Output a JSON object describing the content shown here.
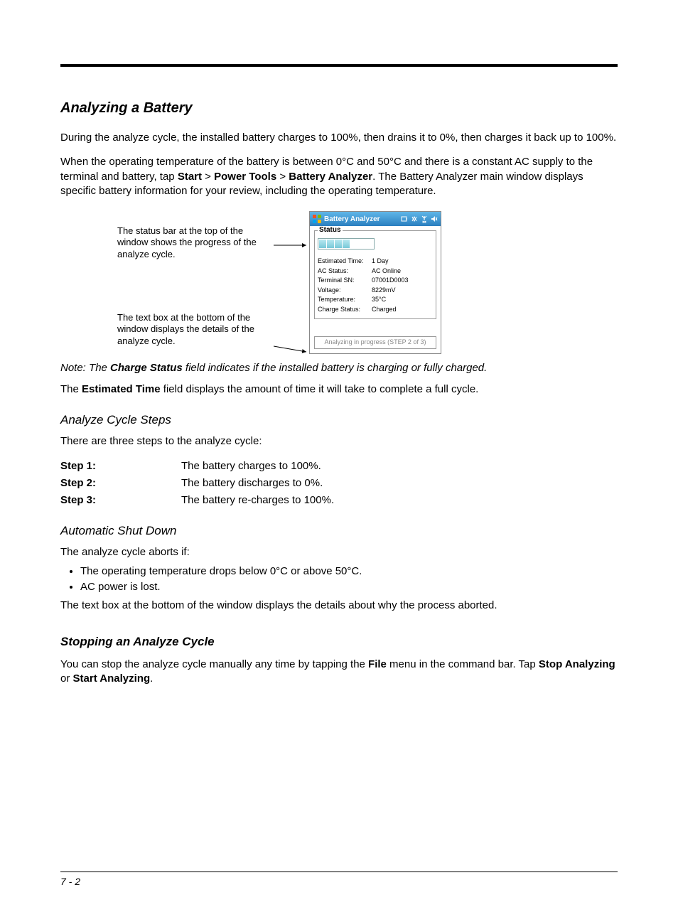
{
  "heading_analyzing": "Analyzing a Battery",
  "para1": "During the analyze cycle, the installed battery charges to 100%, then drains it to 0%, then charges it back up to 100%.",
  "para2_a": "When the operating temperature of the battery is between 0°C and 50°C and there is a constant AC supply to the terminal and battery, tap ",
  "para2_start": "Start",
  "para2_gt1": " > ",
  "para2_pt": "Power Tools",
  "para2_gt2": " > ",
  "para2_ba": "Battery Analyzer",
  "para2_b": ". The Battery Analyzer main window displays specific battery information for your review, including the operating temperature.",
  "callout1": "The status bar at the top of the window shows the progress of the analyze cycle.",
  "callout2": "The text box at the bottom of the window displays the details of the analyze cycle.",
  "app": {
    "title": "Battery Analyzer",
    "status_legend": "Status",
    "rows": [
      {
        "label": "Estimated Time:",
        "value": "1 Day"
      },
      {
        "label": "AC Status:",
        "value": "AC Online"
      },
      {
        "label": "Terminal SN:",
        "value": "07001D0003"
      },
      {
        "label": "Voltage:",
        "value": "8229mV"
      },
      {
        "label": "Temperature:",
        "value": "35°C"
      },
      {
        "label": "Charge Status:",
        "value": "Charged"
      }
    ],
    "progress_text": "Analyzing in progress (STEP 2 of 3)"
  },
  "note_prefix": "Note: ",
  "note_a": "The ",
  "note_field": "Charge Status",
  "note_b": " field indicates if the installed battery is charging or fully charged.",
  "para_est_a": "The ",
  "para_est_field": "Estimated Time",
  "para_est_b": " field displays the amount of time it will take to complete a full cycle.",
  "heading_steps": "Analyze Cycle Steps",
  "para_steps_intro": "There are three steps to the analyze cycle:",
  "steps": [
    {
      "label": "Step 1:",
      "text": "The battery charges to 100%."
    },
    {
      "label": "Step 2:",
      "text": "The battery discharges to 0%."
    },
    {
      "label": "Step 3:",
      "text": "The battery re-charges to 100%."
    }
  ],
  "heading_auto": "Automatic Shut Down",
  "para_auto_intro": "The analyze cycle aborts if:",
  "bullets": [
    "The operating temperature drops below 0°C or above 50°C.",
    "AC power is lost."
  ],
  "para_auto_after": "The text box at the bottom of the window displays the details about why the process aborted.",
  "heading_stop": "Stopping an Analyze Cycle",
  "para_stop_a": "You can stop the analyze cycle manually any time by tapping the ",
  "para_stop_file": "File",
  "para_stop_b": " menu in the command bar. Tap ",
  "para_stop_stop": "Stop Analyzing",
  "para_stop_or": " or ",
  "para_stop_start": "Start Analyzing",
  "para_stop_end": ".",
  "page_num": "7 - 2"
}
